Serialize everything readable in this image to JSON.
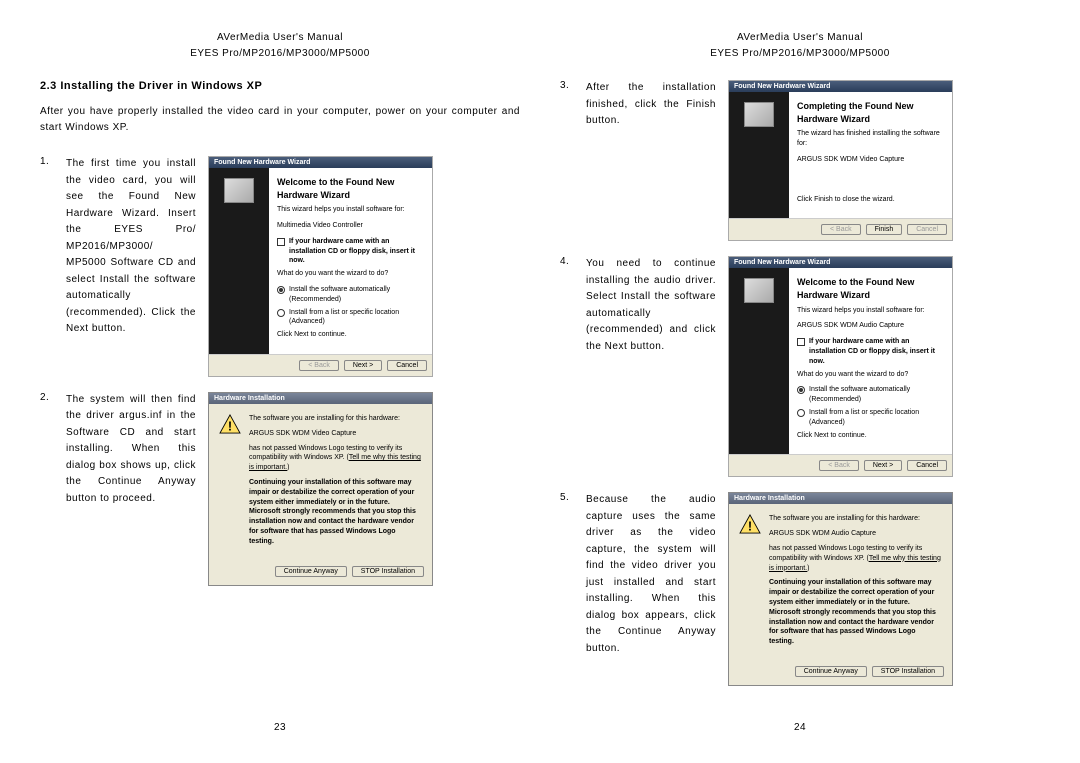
{
  "header": {
    "title": "AVerMedia User's Manual",
    "subtitle": "EYES Pro/MP2016/MP3000/MP5000"
  },
  "left": {
    "section": "2.3 Installing the Driver in Windows XP",
    "intro": "After you have properly installed the video card in your computer, power on your computer and start Windows XP.",
    "step1": {
      "num": "1.",
      "text": "The first time you install the video card, you will see the Found New Hardware Wizard. Insert the EYES Pro/ MP2016/MP3000/ MP5000 Software CD and select Install the software automatically (recommended). Click the Next button."
    },
    "step2": {
      "num": "2.",
      "text": "The system will then find the driver argus.inf in the Software CD and start installing. When this dialog box shows up, click the Continue Anyway button to proceed."
    },
    "pagenum": "23"
  },
  "right": {
    "step3": {
      "num": "3.",
      "text": "After the installation finished, click the Finish button."
    },
    "step4": {
      "num": "4.",
      "text": "You need to continue installing the audio driver. Select Install the software automatically (recommended) and click the Next button."
    },
    "step5": {
      "num": "5.",
      "text": "Because the audio capture uses the same driver as the video capture, the system will find the video driver you just installed and start installing. When this dialog box appears, click the Continue Anyway button."
    },
    "pagenum": "24"
  },
  "wiz": {
    "title": "Found New Hardware Wizard",
    "welcome": "Welcome to the Found New Hardware Wizard",
    "completing": "Completing the Found New Hardware Wizard",
    "helps": "This wizard helps you install software for:",
    "video_dev": "Multimedia Video Controller",
    "audio_dev": "ARGUS SDK WDM Audio Capture",
    "finished_text": "The wizard has finished installing the software for:",
    "finished_dev": "ARGUS SDK WDM Video Capture",
    "click_finish": "Click Finish to close the wizard.",
    "cd_hint": "If your hardware came with an installation CD or floppy disk, insert it now.",
    "what_do": "What do you want the wizard to do?",
    "opt1": "Install the software automatically (Recommended)",
    "opt2": "Install from a list or specific location (Advanced)",
    "click_next": "Click Next to continue.",
    "back": "< Back",
    "next": "Next >",
    "finish": "Finish",
    "cancel": "Cancel"
  },
  "hw": {
    "title": "Hardware Installation",
    "line1": "The software you are installing for this hardware:",
    "dev_video": "ARGUS SDK WDM Video Capture",
    "dev_audio": "ARGUS SDK WDM Audio Capture",
    "logo": "has not passed Windows Logo testing to verify its compatibility with Windows XP. (",
    "tell": "Tell me why this testing is important.",
    "logo2": ")",
    "warn": "Continuing your installation of this software may impair or destabilize the correct operation of your system either immediately or in the future. Microsoft strongly recommends that you stop this installation now and contact the hardware vendor for software that has passed Windows Logo testing.",
    "cont": "Continue Anyway",
    "stop": "STOP Installation"
  }
}
